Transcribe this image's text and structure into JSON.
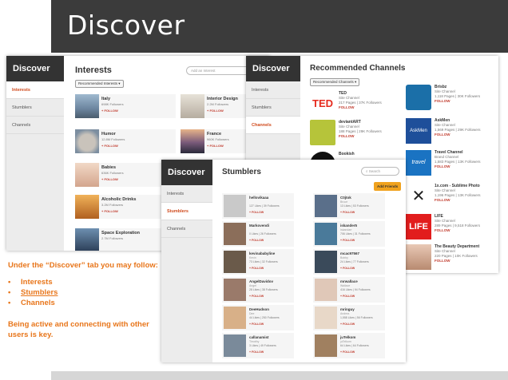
{
  "slide": {
    "title": "Discover",
    "caption_intro": "Under the “Discover” tab you may follow:",
    "caption_items": [
      "Interests",
      "Stumblers",
      "Channels"
    ],
    "caption_outro": "Being active and connecting with other users is key."
  },
  "interests_panel": {
    "nav_title": "Discover",
    "nav": [
      "Interests",
      "Stumblers",
      "Channels"
    ],
    "heading": "Interests",
    "filter": "Recommended Interests ▾",
    "search_placeholder": "Add an Interest",
    "follow": "FOLLOW",
    "items": [
      {
        "name": "Italy",
        "followers": "698K Followers"
      },
      {
        "name": "Interior Design",
        "followers": "2.2M Followers"
      },
      {
        "name": "Humor",
        "followers": "12.8M Followers"
      },
      {
        "name": "France",
        "followers": "960K Followers"
      },
      {
        "name": "Babies",
        "followers": "636K Followers"
      },
      {
        "name": "Alcoholic Drinks",
        "followers": "3.2M Followers"
      },
      {
        "name": "Space Exploration",
        "followers": "2.7M Followers"
      }
    ]
  },
  "channels_panel": {
    "nav_title": "Discover",
    "nav": [
      "Interests",
      "Stumblers",
      "Channels"
    ],
    "heading": "Recommended Channels",
    "filter": "Recommended Channels ▾",
    "follow": "FOLLOW",
    "items": [
      {
        "name": "TED",
        "type": "Site Channel",
        "stats": "217 Pages | 37K Followers"
      },
      {
        "name": "deviantART",
        "type": "Site Channel",
        "stats": "188 Pages | 29K Followers"
      },
      {
        "name": "Bookish",
        "type": "",
        "stats": ""
      },
      {
        "name": "Brisbz",
        "type": "Site Channel",
        "stats": "1,118 Pages | 30K Followers"
      },
      {
        "name": "AskMen",
        "type": "Site Channel",
        "stats": "1,569 Pages | 29K Followers"
      },
      {
        "name": "Travel Channel",
        "type": "Brand Channel",
        "stats": "1,583 Pages | 13K Followers"
      },
      {
        "name": "1x.com - Sublime Photo",
        "type": "Site Channel",
        "stats": "1,196 Pages | 13K Followers"
      },
      {
        "name": "LIFE",
        "type": "Site Channel",
        "stats": "289 Pages | 9,518 Followers"
      },
      {
        "name": "The Beauty Department",
        "type": "Site Channel",
        "stats": "220 Pages | 10K Followers"
      }
    ]
  },
  "stumblers_panel": {
    "nav_title": "Discover",
    "nav": [
      "Interests",
      "Stumblers",
      "Channels"
    ],
    "heading": "Stumblers",
    "search_placeholder": "Search",
    "add_friends": "Add Friends",
    "follow": "FOLLOW",
    "items": [
      {
        "name": "hellovikaaa",
        "stats": "127 Likes | 39 Followers"
      },
      {
        "name": "C0jtok",
        "real": "Bruce",
        "stats": "13 Likes | 53 Followers"
      },
      {
        "name": "Markovendi",
        "stats": "0 Likes | 26 Followers"
      },
      {
        "name": "iskander5",
        "real": "Iskandarr",
        "stats": "706 Likes | 31 Followers"
      },
      {
        "name": "kevinababyline",
        "real": "Kevin",
        "stats": "73 Likes | 32 Followers"
      },
      {
        "name": "mcac97567",
        "real": "Bobby",
        "stats": "24 Likes | 77 Followers"
      },
      {
        "name": "AngelDavidov",
        "real": "Angel",
        "stats": "28 Likes | 38 Followers"
      },
      {
        "name": "mrwallace",
        "real": "Wallace",
        "stats": "416 Likes | 94 Followers"
      },
      {
        "name": "DeeHudson",
        "real": "Dee",
        "stats": "44 Likes | 250 Followers"
      },
      {
        "name": "mringuy",
        "real": "Andrea",
        "stats": "1,558 Likes | 56 Followers"
      },
      {
        "name": "callanamist",
        "real": "Timothy",
        "stats": "3 Likes | 49 Followers"
      },
      {
        "name": "juTelkom",
        "real": "juTelkom",
        "stats": "64 Likes | 64 Followers"
      }
    ]
  }
}
